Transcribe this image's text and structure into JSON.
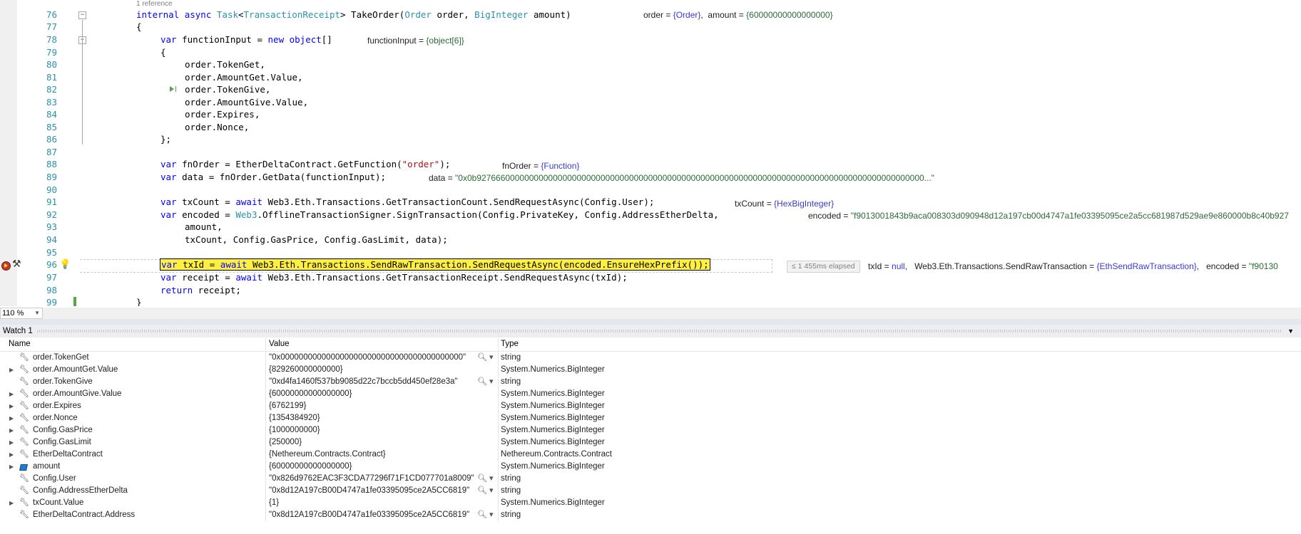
{
  "editor": {
    "ref_hint": "1 reference",
    "line_numbers": [
      "76",
      "77",
      "78",
      "79",
      "80",
      "81",
      "82",
      "83",
      "84",
      "85",
      "86",
      "87",
      "88",
      "89",
      "90",
      "91",
      "92",
      "93",
      "94",
      "95",
      "96",
      "97",
      "98",
      "99"
    ],
    "datatips": {
      "l76_order_name": "order",
      "l76_order_val": "{Order}",
      "l76_amount_name": "amount",
      "l76_amount_val": "{60000000000000000}",
      "l78_name": "functionInput",
      "l78_val": "{object[6]}",
      "l88_name": "fnOrder",
      "l88_val": "{Function}",
      "l89_name": "data",
      "l89_val": "\"0x0b9276660000000000000000000000000000000000000000000000000000000000000000000000000000000000000000...\"",
      "l91_name": "txCount",
      "l91_val": "{HexBigInteger}",
      "l92_name": "encoded",
      "l92_val": "\"f9013001843b9aca008303d090948d12a197cb00d4747a1fe03395095ce2a5cc681987d529ae9e860000b8c40b927",
      "l96_elapsed": "≤ 1 455ms elapsed",
      "l96_txid_name": "txId",
      "l96_txid_val": "null",
      "l96_send_name": "Web3.Eth.Transactions.SendRawTransaction",
      "l96_send_val": "{EthSendRawTransaction}",
      "l96_enc_name": "encoded",
      "l96_enc_val": "\"f90130"
    }
  },
  "zoom": "110 %",
  "watch": {
    "title": "Watch 1",
    "columns": {
      "name": "Name",
      "value": "Value",
      "type": "Type"
    },
    "rows": [
      {
        "name": "order.TokenGet",
        "value": "\"0x0000000000000000000000000000000000000000\"",
        "type": "string",
        "expandable": false,
        "icon": "wrench-icon",
        "magnifier": true
      },
      {
        "name": "order.AmountGet.Value",
        "value": "{829260000000000}",
        "type": "System.Numerics.BigInteger",
        "expandable": true,
        "icon": "wrench-icon",
        "magnifier": false
      },
      {
        "name": "order.TokenGive",
        "value": "\"0xd4fa1460f537bb9085d22c7bccb5dd450ef28e3a\"",
        "type": "string",
        "expandable": false,
        "icon": "wrench-icon",
        "magnifier": true
      },
      {
        "name": "order.AmountGive.Value",
        "value": "{60000000000000000}",
        "type": "System.Numerics.BigInteger",
        "expandable": true,
        "icon": "wrench-icon",
        "magnifier": false
      },
      {
        "name": "order.Expires",
        "value": "{6762199}",
        "type": "System.Numerics.BigInteger",
        "expandable": true,
        "icon": "wrench-icon",
        "magnifier": false
      },
      {
        "name": "order.Nonce",
        "value": "{1354384920}",
        "type": "System.Numerics.BigInteger",
        "expandable": true,
        "icon": "wrench-icon",
        "magnifier": false
      },
      {
        "name": "Config.GasPrice",
        "value": "{1000000000}",
        "type": "System.Numerics.BigInteger",
        "expandable": true,
        "icon": "wrench-icon",
        "magnifier": false
      },
      {
        "name": "Config.GasLimit",
        "value": "{250000}",
        "type": "System.Numerics.BigInteger",
        "expandable": true,
        "icon": "wrench-icon",
        "magnifier": false
      },
      {
        "name": "EtherDeltaContract",
        "value": "{Nethereum.Contracts.Contract}",
        "type": "Nethereum.Contracts.Contract",
        "expandable": true,
        "icon": "wrench-icon",
        "magnifier": false
      },
      {
        "name": "amount",
        "value": "{60000000000000000}",
        "type": "System.Numerics.BigInteger",
        "expandable": true,
        "icon": "local-variable-icon",
        "magnifier": false
      },
      {
        "name": "Config.User",
        "value": "\"0x826d9762EAC3F3CDA77296f71F1CD077701a8009\"",
        "type": "string",
        "expandable": false,
        "icon": "wrench-icon",
        "magnifier": true
      },
      {
        "name": "Config.AddressEtherDelta",
        "value": "\"0x8d12A197cB00D4747a1fe03395095ce2A5CC6819\"",
        "type": "string",
        "expandable": false,
        "icon": "wrench-icon",
        "magnifier": true
      },
      {
        "name": "txCount.Value",
        "value": "{1}",
        "type": "System.Numerics.BigInteger",
        "expandable": true,
        "icon": "wrench-icon",
        "magnifier": false
      },
      {
        "name": "EtherDeltaContract.Address",
        "value": "\"0x8d12A197cB00D4747a1fe03395095ce2A5CC6819\"",
        "type": "string",
        "expandable": false,
        "icon": "wrench-icon",
        "magnifier": true
      }
    ]
  },
  "colors": {
    "accent_yellow": "#ffef3f",
    "keyword": "#0000ff",
    "type": "#2b91af",
    "string": "#a31515",
    "breakpoint": "#c0392b"
  }
}
